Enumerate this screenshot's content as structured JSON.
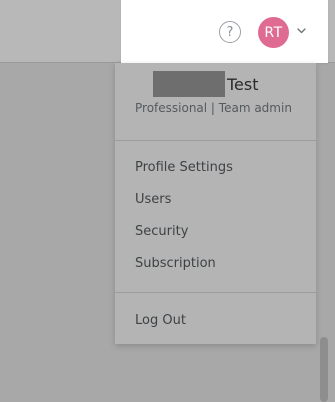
{
  "header": {
    "help_glyph": "?",
    "help_icon": "question-circle-icon",
    "avatar_initials": "RT",
    "avatar_color": "#e06b92",
    "chevron_icon": "chevron-down-icon"
  },
  "account_menu": {
    "user_name": "Test",
    "plan_label": "Professional | Team admin",
    "items": [
      {
        "label": "Profile Settings"
      },
      {
        "label": "Users"
      },
      {
        "label": "Security"
      },
      {
        "label": "Subscription"
      }
    ],
    "logout_label": "Log Out"
  }
}
